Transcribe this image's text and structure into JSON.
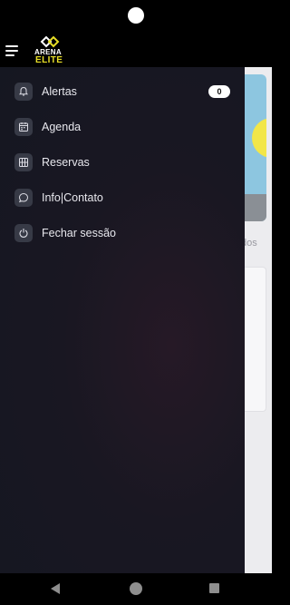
{
  "header": {
    "logo_line1": "ARENA",
    "logo_line2": "ELITE",
    "accent_color": "#e8df27"
  },
  "background": {
    "partial_text": "dos"
  },
  "drawer": {
    "items": [
      {
        "label": "Alertas",
        "icon": "bell-icon",
        "badge": "0"
      },
      {
        "label": "Agenda",
        "icon": "calendar-icon"
      },
      {
        "label": "Reservas",
        "icon": "grid-icon"
      },
      {
        "label": "Info|Contato",
        "icon": "chat-icon"
      },
      {
        "label": "Fechar sessão",
        "icon": "power-icon"
      }
    ]
  }
}
